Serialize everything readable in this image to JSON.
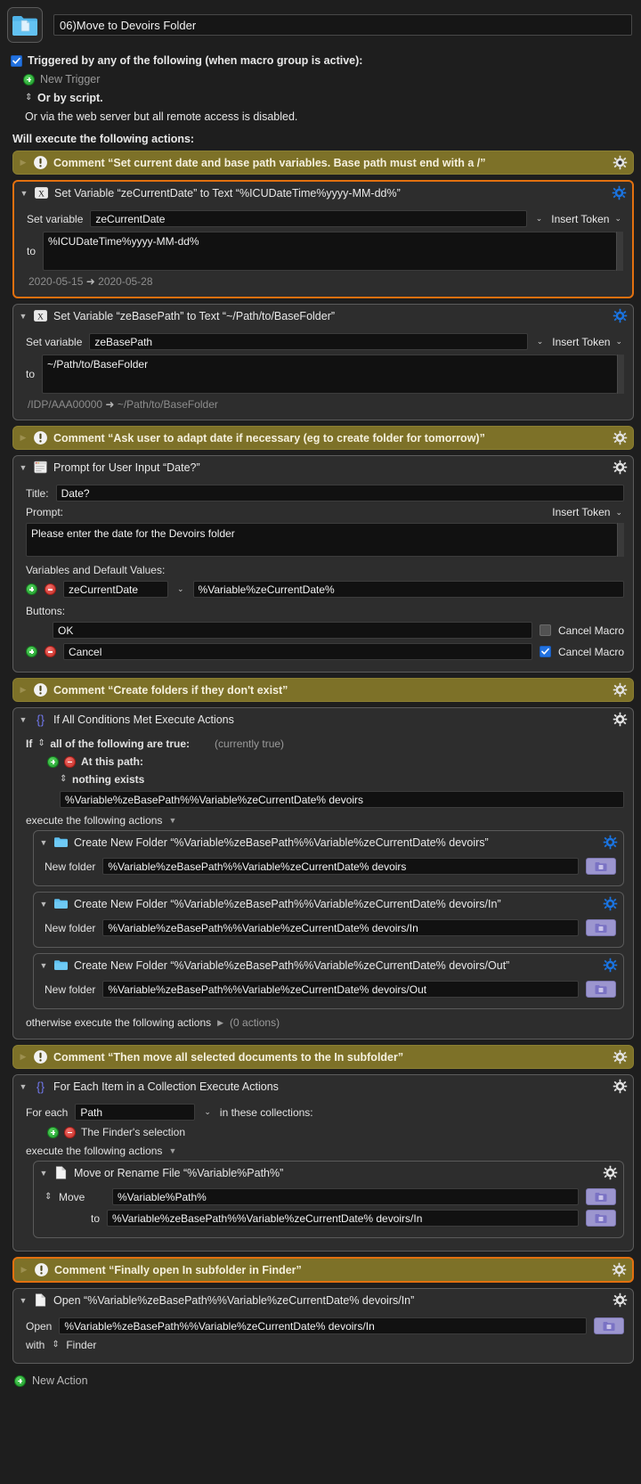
{
  "macro": {
    "icon": "blue-folder-document-icon",
    "name": "06)Move to Devoirs Folder"
  },
  "triggers": {
    "checkbox_label": "Triggered by any of the following (when macro group is active):",
    "new_trigger": "New Trigger",
    "or_by_script": "Or by script.",
    "web_server_note": "Or via the web server but all remote access is disabled.",
    "will_execute": "Will execute the following actions:"
  },
  "colors": {
    "comment_bg": "#7d7128",
    "selected_border": "#e2700f",
    "gear_enabled": "#1a74e2",
    "gear_disabled": "#d8d8d8",
    "checkbox_blue": "#2272e0"
  },
  "actions": [
    {
      "type": "comment",
      "name": "comment-set-current-date",
      "title": "Comment “Set current date and base path variables. Base path must end with a /”",
      "collapsed": true,
      "selected": false,
      "gear": "gear-icon-white"
    },
    {
      "type": "set-variable",
      "name": "set-variable-zecurrentdate",
      "title": "Set Variable “zeCurrentDate” to Text “%ICUDateTime%yyyy-MM-dd%”",
      "selected": true,
      "gear": "gear-icon-blue",
      "set_variable_label": "Set variable",
      "variable_name": "zeCurrentDate",
      "insert_token": "Insert Token",
      "to_label": "to",
      "to_value": "%ICUDateTime%yyyy-MM-dd%",
      "result_from": "2020-05-15",
      "result_to": "2020-05-28"
    },
    {
      "type": "set-variable",
      "name": "set-variable-zebasepath",
      "title": "Set Variable “zeBasePath” to Text “~/Path/to/BaseFolder”",
      "selected": false,
      "gear": "gear-icon-blue",
      "set_variable_label": "Set variable",
      "variable_name": "zeBasePath",
      "insert_token": "Insert Token",
      "to_label": "to",
      "to_value": "~/Path/to/BaseFolder",
      "result_from": "/IDP/AAA00000",
      "result_to": "~/Path/to/BaseFolder"
    },
    {
      "type": "comment",
      "name": "comment-ask-user-adapt-date",
      "title": "Comment “Ask user to adapt date if necessary (eg to create folder for tomorrow)”",
      "collapsed": true,
      "selected": false,
      "gear": "gear-icon-white"
    },
    {
      "type": "prompt",
      "name": "prompt-for-user-input",
      "title": "Prompt for User Input “Date?”",
      "selected": false,
      "gear": "gear-icon-white",
      "title_label": "Title:",
      "title_value": "Date?",
      "prompt_label": "Prompt:",
      "insert_token": "Insert Token",
      "prompt_value": "Please enter the date for the Devoirs folder",
      "vars_label": "Variables and Default Values:",
      "var_name": "zeCurrentDate",
      "var_default": "%Variable%zeCurrentDate%",
      "buttons_label": "Buttons:",
      "buttons": [
        {
          "label": "OK",
          "cancel_macro_label": "Cancel Macro",
          "cancel_macro": false,
          "has_addremove": false
        },
        {
          "label": "Cancel",
          "cancel_macro_label": "Cancel Macro",
          "cancel_macro": true,
          "has_addremove": true
        }
      ]
    },
    {
      "type": "comment",
      "name": "comment-create-folders",
      "title": "Comment “Create folders if they don't exist”",
      "collapsed": true,
      "selected": false,
      "gear": "gear-icon-white"
    },
    {
      "type": "if-then",
      "name": "if-all-conditions-met",
      "title": "If All Conditions Met Execute Actions",
      "selected": false,
      "gear": "gear-icon-white",
      "if_label": "If",
      "condition_mode": "all of the following are true:",
      "currently": "(currently true)",
      "condition_title": "At this path:",
      "condition_op": "nothing exists",
      "condition_path": "%Variable%zeBasePath%%Variable%zeCurrentDate% devoirs",
      "execute_label": "execute the following actions",
      "otherwise_label": "otherwise execute the following actions",
      "otherwise_count": "(0 actions)",
      "children": [
        {
          "name": "create-new-folder-devoirs",
          "title": "Create New Folder “%Variable%zeBasePath%%Variable%zeCurrentDate% devoirs”",
          "field_label": "New folder",
          "field_value": "%Variable%zeBasePath%%Variable%zeCurrentDate% devoirs",
          "gear": "gear-icon-blue"
        },
        {
          "name": "create-new-folder-devoirs-in",
          "title": "Create New Folder “%Variable%zeBasePath%%Variable%zeCurrentDate% devoirs/In”",
          "field_label": "New folder",
          "field_value": "%Variable%zeBasePath%%Variable%zeCurrentDate% devoirs/In",
          "gear": "gear-icon-blue"
        },
        {
          "name": "create-new-folder-devoirs-out",
          "title": "Create New Folder “%Variable%zeBasePath%%Variable%zeCurrentDate% devoirs/Out”",
          "field_label": "New folder",
          "field_value": "%Variable%zeBasePath%%Variable%zeCurrentDate% devoirs/Out",
          "gear": "gear-icon-blue"
        }
      ]
    },
    {
      "type": "comment",
      "name": "comment-move-documents",
      "title": "Comment “Then move all selected documents to the In subfolder”",
      "collapsed": true,
      "selected": false,
      "gear": "gear-icon-white"
    },
    {
      "type": "for-each",
      "name": "for-each-item-in-collection",
      "title": "For Each Item in a Collection Execute Actions",
      "selected": false,
      "gear": "gear-icon-white",
      "for_each_label": "For each",
      "for_each_value": "Path",
      "in_collections_label": "in these collections:",
      "collection_item": "The Finder's selection",
      "execute_label": "execute the following actions",
      "children": [
        {
          "name": "move-or-rename-file",
          "title": "Move or Rename File “%Variable%Path%”",
          "op_label": "Move",
          "source_value": "%Variable%Path%",
          "to_label": "to",
          "to_value": "%Variable%zeBasePath%%Variable%zeCurrentDate% devoirs/In",
          "gear": "gear-icon-white"
        }
      ]
    },
    {
      "type": "comment",
      "name": "comment-open-in-subfolder",
      "title": "Comment “Finally open In subfolder in Finder”",
      "collapsed": true,
      "selected": true,
      "gear": "gear-icon-white"
    },
    {
      "type": "open-file",
      "name": "open-file-action",
      "title": "Open “%Variable%zeBasePath%%Variable%zeCurrentDate% devoirs/In”",
      "selected": false,
      "gear": "gear-icon-white",
      "open_label": "Open",
      "open_value": "%Variable%zeBasePath%%Variable%zeCurrentDate% devoirs/In",
      "with_label": "with",
      "with_value": "Finder"
    }
  ],
  "footer": {
    "new_action": "New Action"
  }
}
